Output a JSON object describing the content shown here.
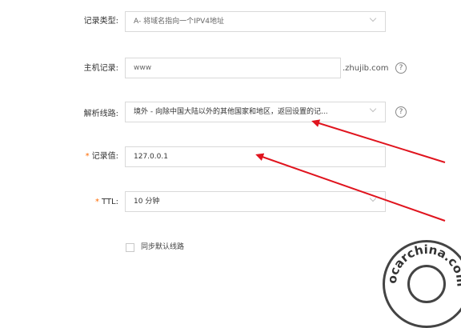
{
  "form": {
    "record_type": {
      "label": "记录类型:",
      "value": "A- 将域名指向一个IPV4地址"
    },
    "host": {
      "label": "主机记录:",
      "value": "www",
      "suffix": ".zhujib.com",
      "help": "?"
    },
    "line": {
      "label": "解析线路:",
      "value": "境外 - 向除中国大陆以外的其他国家和地区，返回设置的记...",
      "help": "?"
    },
    "record_value": {
      "required_mark": "*",
      "label": "记录值:",
      "value": "127.0.0.1"
    },
    "ttl": {
      "required_mark": "*",
      "label": "TTL:",
      "value": "10 分钟"
    },
    "sync_default_line": {
      "label": "同步默认线路",
      "checked": false
    }
  },
  "annotations": {
    "arrow_color": "#e0141e"
  },
  "watermark": {
    "text": "ocarchina.com"
  }
}
